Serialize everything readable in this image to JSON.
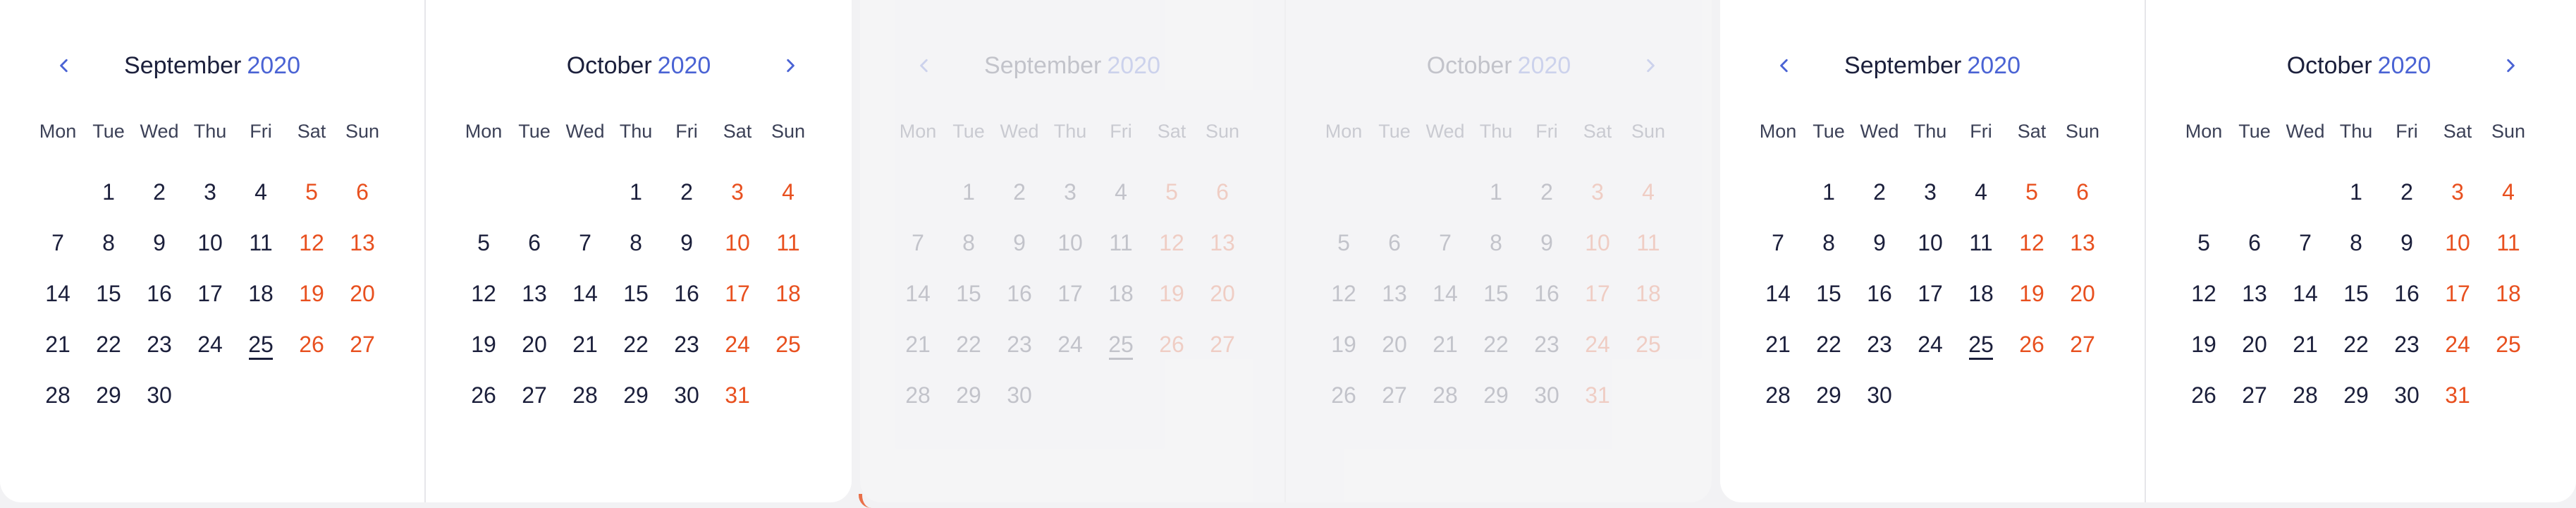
{
  "colors": {
    "accent": "#4a63d4",
    "weekend": "#e8501f",
    "text": "#1b1f3b"
  },
  "weekdays": [
    "Mon",
    "Tue",
    "Wed",
    "Thu",
    "Fri",
    "Sat",
    "Sun"
  ],
  "panels": [
    {
      "state": "active",
      "left": {
        "month": "September",
        "year": "2020",
        "offset": 1,
        "days": 30,
        "today": 25
      },
      "right": {
        "month": "October",
        "year": "2020",
        "offset": 3,
        "days": 31,
        "today": null
      }
    },
    {
      "state": "ghost",
      "left": {
        "month": "September",
        "year": "2020",
        "offset": 1,
        "days": 30,
        "today": 25
      },
      "right": {
        "month": "October",
        "year": "2020",
        "offset": 3,
        "days": 31,
        "today": null
      }
    },
    {
      "state": "active",
      "left": {
        "month": "September",
        "year": "2020",
        "offset": 1,
        "days": 30,
        "today": 25
      },
      "right": {
        "month": "October",
        "year": "2020",
        "offset": 3,
        "days": 31,
        "today": null
      }
    }
  ],
  "icons": {
    "prev": "chevron-left-icon",
    "next": "chevron-right-icon"
  }
}
